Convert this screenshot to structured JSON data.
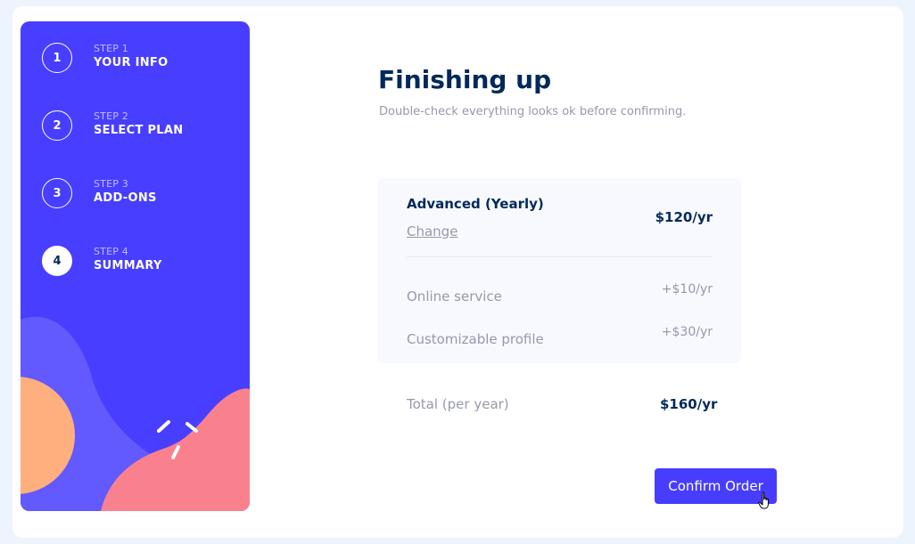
{
  "sidebar": {
    "steps": [
      {
        "number": "1",
        "sub": "STEP 1",
        "title": "YOUR INFO",
        "active": false
      },
      {
        "number": "2",
        "sub": "STEP 2",
        "title": "SELECT PLAN",
        "active": false
      },
      {
        "number": "3",
        "sub": "STEP 3",
        "title": "ADD-ONS",
        "active": false
      },
      {
        "number": "4",
        "sub": "STEP 4",
        "title": "SUMMARY",
        "active": true
      }
    ]
  },
  "main": {
    "title": "Finishing up",
    "subtitle": "Double-check everything looks ok before confirming.",
    "plan": {
      "name": "Advanced (Yearly)",
      "change_label": "Change",
      "price": "$120/yr"
    },
    "addons": [
      {
        "name": "Online service",
        "price": "+$10/yr"
      },
      {
        "name": "Customizable profile",
        "price": "+$30/yr"
      }
    ],
    "total": {
      "label": "Total (per year)",
      "price": "$160/yr"
    },
    "confirm_label": "Confirm Order"
  },
  "colors": {
    "sidebar_bg": "#483eff",
    "accent": "#473dff",
    "marine_blue": "#02295a",
    "cool_gray": "#9699ab",
    "shape_orange": "#ffaf7e",
    "shape_pink": "#f9818e",
    "shape_lavender": "#6259ff"
  },
  "icons": {
    "cursor": "hand-pointer-icon"
  }
}
